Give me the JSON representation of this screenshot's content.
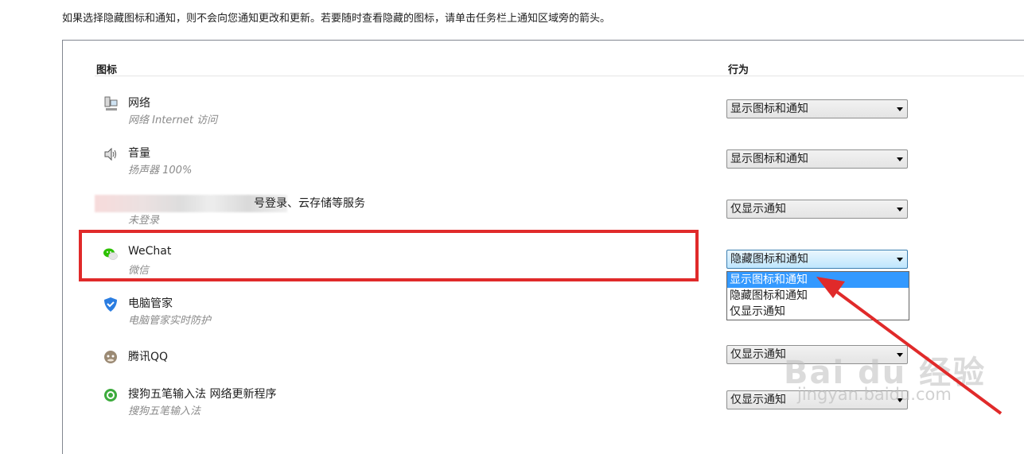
{
  "intro_text": "如果选择隐藏图标和通知，则不会向您通知更改和更新。若要随时查看隐藏的图标，请单击任务栏上通知区域旁的箭头。",
  "headers": {
    "icon": "图标",
    "behavior": "行为"
  },
  "rows": [
    {
      "name": "网络",
      "desc": "网络 Internet 访问",
      "icon": "network-icon",
      "behavior": "显示图标和通知"
    },
    {
      "name": "音量",
      "desc": "扬声器 100%",
      "icon": "speaker-icon",
      "behavior": "显示图标和通知"
    },
    {
      "name": "号登录、云存储等服务",
      "desc": "未登录",
      "icon": "blurred-icon",
      "behavior": "仅显示通知"
    },
    {
      "name": "WeChat",
      "desc": "微信",
      "icon": "wechat-icon",
      "behavior": "隐藏图标和通知"
    },
    {
      "name": "电脑管家",
      "desc": "电脑管家实时防护",
      "icon": "shield-icon"
    },
    {
      "name": "腾讯QQ",
      "desc": "",
      "icon": "qq-icon",
      "behavior": "仅显示通知"
    },
    {
      "name": "搜狗五笔输入法 网络更新程序",
      "desc": "搜狗五笔输入法",
      "icon": "sogou-icon",
      "behavior": "仅显示通知"
    }
  ],
  "dropdown_options": [
    "显示图标和通知",
    "隐藏图标和通知",
    "仅显示通知"
  ],
  "dropdown_highlighted": "显示图标和通知",
  "watermark": {
    "text": "Bai du 经验",
    "subtext": "jingyan.baidu.com"
  },
  "colors": {
    "highlight": "#3399ff",
    "annotation_red": "#e02a2a"
  }
}
